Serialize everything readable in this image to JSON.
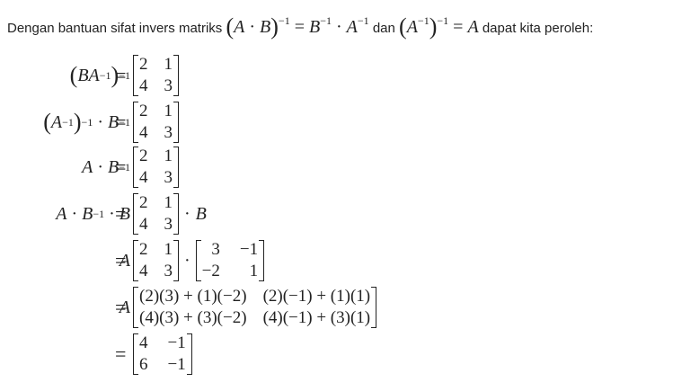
{
  "intro": {
    "text_before": "Dengan bantuan sifat invers matriks",
    "text_mid": "dan",
    "text_after": "dapat kita peroleh:"
  },
  "steps": [
    {
      "lhs": "(BA⁻¹)⁻¹",
      "rhs": "[[2,1],[4,3]]"
    },
    {
      "lhs": "(A⁻¹)⁻¹ · B⁻¹",
      "rhs": "[[2,1],[4,3]]"
    },
    {
      "lhs": "A · B⁻¹",
      "rhs": "[[2,1],[4,3]]"
    },
    {
      "lhs": "A · B⁻¹ · B",
      "rhs": "[[2,1],[4,3]] · B"
    },
    {
      "lhs": "A",
      "rhs": "[[2,1],[4,3]] · [[3,−1],[−2,1]]"
    },
    {
      "lhs": "A",
      "rhs": "[[(2)(3) + (1)(−2), (2)(−1) + (1)(1)],[(4)(3) + (3)(−2), (4)(−1) + (3)(1)]]"
    },
    {
      "lhs": "",
      "rhs": "[[4,−1],[6,−1]]"
    }
  ],
  "matrices": {
    "m21": [
      "2",
      "1",
      "4",
      "3"
    ],
    "binv": [
      "3",
      "−1",
      "−2",
      "1"
    ],
    "product": [
      "(2)(3) + (1)(−2)",
      "(2)(−1) + (1)(1)",
      "(4)(3) + (3)(−2)",
      "(4)(−1) + (3)(1)"
    ],
    "result": [
      "4",
      "−1",
      "6",
      "−1"
    ]
  },
  "symbols": {
    "equals": "=",
    "dot": "·",
    "B": "B"
  }
}
